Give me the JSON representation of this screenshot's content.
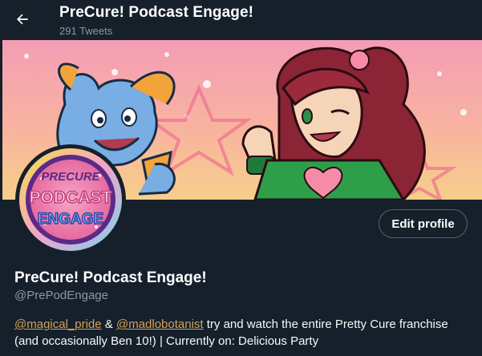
{
  "header": {
    "title": "PreCure! Podcast Engage!",
    "tweet_count": "291 Tweets",
    "back_icon": "arrow-left-icon"
  },
  "banner": {
    "description_colors": {
      "sky_top": "#f7a2b7",
      "sky_bottom": "#f7c88d",
      "hair": "#8b2434",
      "outfit": "#2e9e4a"
    }
  },
  "avatar": {
    "logo_text_line1": "PRECURE",
    "logo_text_line2": "PODCAST",
    "logo_text_line3": "ENGAGE"
  },
  "profile": {
    "edit_label": "Edit profile",
    "name": "PreCure! Podcast Engage!",
    "handle": "@PrePodEngage",
    "bio": {
      "mention1": "@magical_pride",
      "amp": " & ",
      "mention2": "@madlobotanist",
      "rest": " try and watch the entire Pretty Cure franchise (and occasionally Ben 10!) | Currently on: Delicious Party"
    }
  },
  "colors": {
    "background": "#15202b",
    "secondary_text": "#8b98a5",
    "link": "#d4a15a",
    "button_border": "#536471"
  }
}
